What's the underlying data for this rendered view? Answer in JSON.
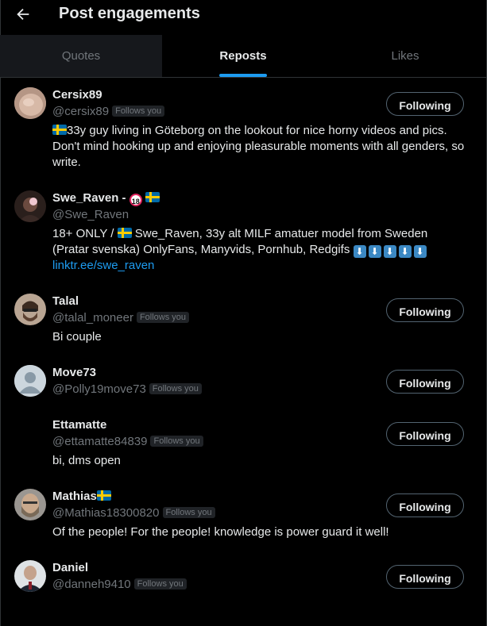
{
  "header": {
    "title": "Post engagements",
    "back_icon": "arrow-left-icon"
  },
  "tabs": [
    {
      "label": "Quotes",
      "state": "inactive"
    },
    {
      "label": "Reposts",
      "state": "active"
    },
    {
      "label": "Likes",
      "state": "inactive"
    }
  ],
  "colors": {
    "accent": "#1d9bf0",
    "background": "#000000",
    "muted": "#71767b",
    "text": "#e7e9ea"
  },
  "users": [
    {
      "name": "Cersix89",
      "handle": "@cersix89",
      "follows_you": "Follows you",
      "button": "Following",
      "bio": "33y guy living in Göteborg on the lookout for nice horny videos and pics. Don't mind hooking up and enjoying pleasurable moments with all genders, so write."
    },
    {
      "name": "Swe_Raven -",
      "handle": "@Swe_Raven",
      "age_badge": "18",
      "bio_part1": "18+ ONLY / ",
      "bio_part2": " Swe_Raven, 33y alt MILF amatuer model from Sweden (Pratar svenska) OnlyFans, Manyvids, Pornhub, Redgifs ",
      "arrow_icon": "⬇",
      "link": "linktr.ee/swe_raven"
    },
    {
      "name": "Talal",
      "handle": "@talal_moneer",
      "follows_you": "Follows you",
      "button": "Following",
      "bio": "Bi couple"
    },
    {
      "name": "Move73",
      "handle": "@Polly19move73",
      "follows_you": "Follows you",
      "button": "Following"
    },
    {
      "name": "Ettamatte",
      "handle": "@ettamatte84839",
      "follows_you": "Follows you",
      "button": "Following",
      "bio": "bi, dms open"
    },
    {
      "name": "Mathias",
      "handle": "@Mathias18300820",
      "follows_you": "Follows you",
      "button": "Following",
      "bio": "Of the people! For the people! knowledge is power guard it well!"
    },
    {
      "name": "Daniel",
      "handle": "@danneh9410",
      "follows_you": "Follows you",
      "button": "Following"
    }
  ]
}
